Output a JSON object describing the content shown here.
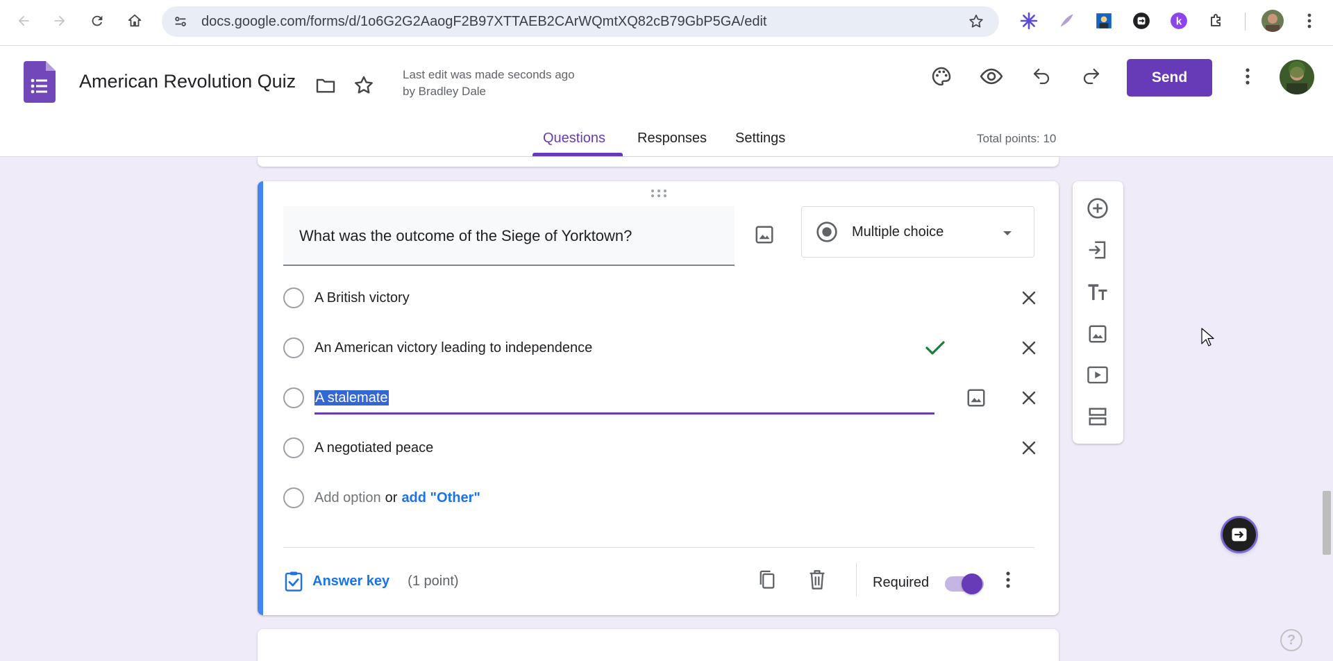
{
  "browser": {
    "url": "docs.google.com/forms/d/1o6G2G2AaogF2B97XTTAEB2CArWQmtXQ82cB79GbP5GA/edit"
  },
  "header": {
    "title": "American Revolution Quiz",
    "last_edit": "Last edit was made seconds ago by Bradley Dale",
    "send_label": "Send",
    "accent_color": "#673ab7"
  },
  "tabs": [
    {
      "label": "Questions",
      "active": true
    },
    {
      "label": "Responses",
      "active": false
    },
    {
      "label": "Settings",
      "active": false
    }
  ],
  "total_points": "Total points: 10",
  "question": {
    "text": "What was the outcome of the Siege of Yorktown?",
    "type": "Multiple choice",
    "options": [
      {
        "label": "A British victory",
        "correct": false
      },
      {
        "label": "An American victory leading to independence",
        "correct": true
      },
      {
        "label": "A stalemate",
        "selected_text": true
      },
      {
        "label": "A negotiated peace",
        "correct": false
      }
    ],
    "add_option": "Add option",
    "or": "or",
    "add_other": "add \"Other\""
  },
  "footer": {
    "answer_key": "Answer key",
    "points": "(1 point)",
    "required_label": "Required",
    "required_on": true
  },
  "help_glyph": "?"
}
